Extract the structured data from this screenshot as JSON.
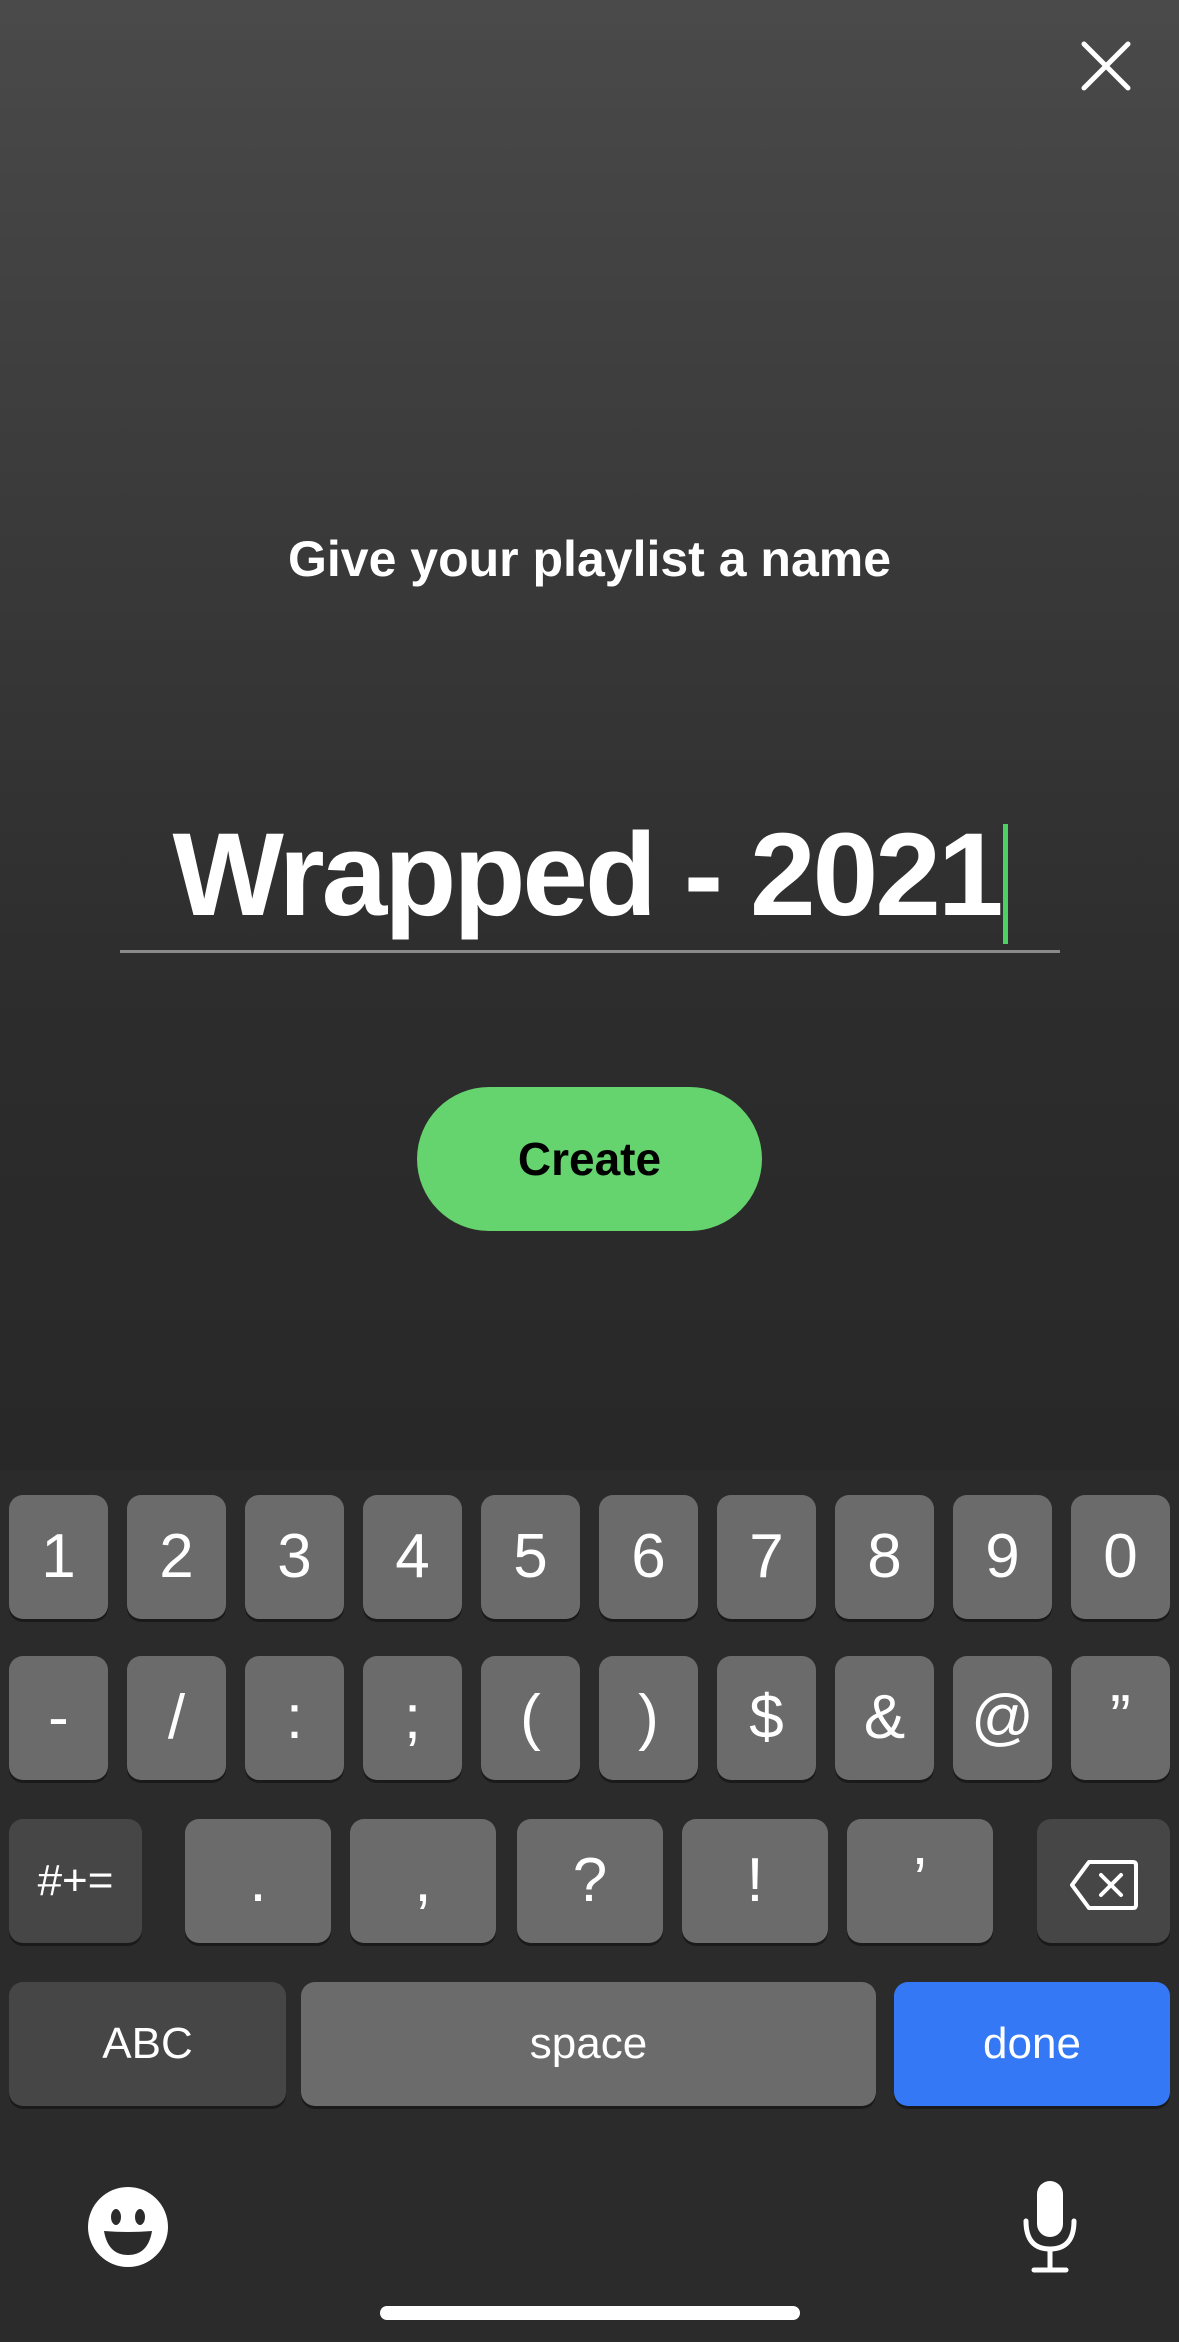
{
  "screen": {
    "title": "Give your playlist a name",
    "name_value": "Wrapped - 2021",
    "create_label": "Create",
    "accent_green": "#65d36e",
    "caret_color": "#4cd264"
  },
  "keyboard": {
    "row1": [
      "1",
      "2",
      "3",
      "4",
      "5",
      "6",
      "7",
      "8",
      "9",
      "0"
    ],
    "row2": [
      "-",
      "/",
      ":",
      ";",
      "(",
      ")",
      "$",
      "&",
      "@",
      "”"
    ],
    "row3": [
      ".",
      ",",
      "?",
      "!",
      "’"
    ],
    "symbols_label": "#+=",
    "abc_label": "ABC",
    "space_label": "space",
    "done_label": "done",
    "done_color": "#3478f6",
    "backspace_icon": "delete-left-icon",
    "emoji_icon": "emoji-icon",
    "mic_icon": "microphone-icon"
  }
}
